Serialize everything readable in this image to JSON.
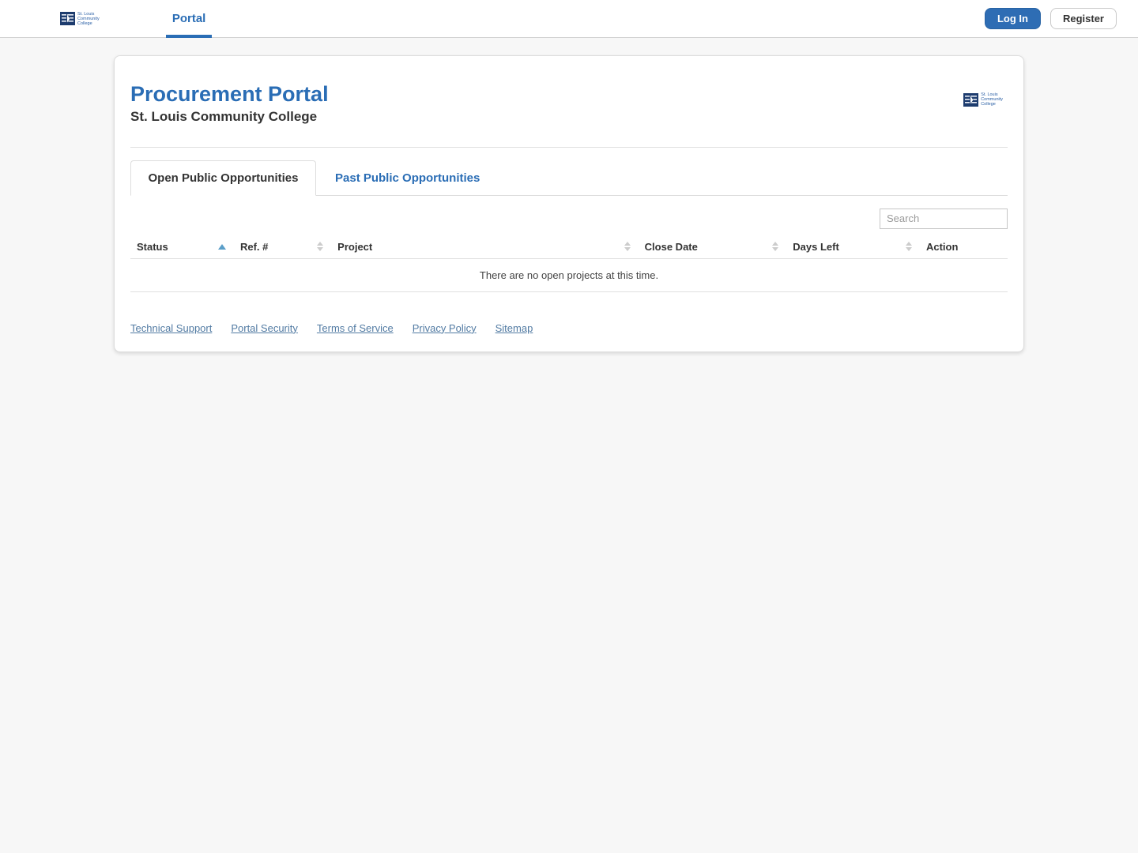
{
  "nav": {
    "portal_label": "Portal",
    "login_label": "Log In",
    "register_label": "Register"
  },
  "logo": {
    "line1": "St. Louis",
    "line2": "Community",
    "line3": "College"
  },
  "header": {
    "title": "Procurement Portal",
    "subtitle": "St. Louis Community College"
  },
  "tabs": [
    {
      "label": "Open Public Opportunities",
      "active": true
    },
    {
      "label": "Past Public Opportunities",
      "active": false
    }
  ],
  "search": {
    "placeholder": "Search"
  },
  "table": {
    "columns": [
      {
        "label": "Status",
        "sort": "asc"
      },
      {
        "label": "Ref. #",
        "sort": "none"
      },
      {
        "label": "Project",
        "sort": "none"
      },
      {
        "label": "Close Date",
        "sort": "none"
      },
      {
        "label": "Days Left",
        "sort": "none"
      },
      {
        "label": "Action",
        "sort": null
      }
    ],
    "empty_message": "There are no open projects at this time."
  },
  "footer": {
    "links": [
      "Technical Support",
      "Portal Security",
      "Terms of Service",
      "Privacy Policy",
      "Sitemap"
    ]
  },
  "colors": {
    "primary_blue": "#2a6db5",
    "footer_link_blue": "#527ba3",
    "sort_active_blue": "#5b9fc9"
  }
}
